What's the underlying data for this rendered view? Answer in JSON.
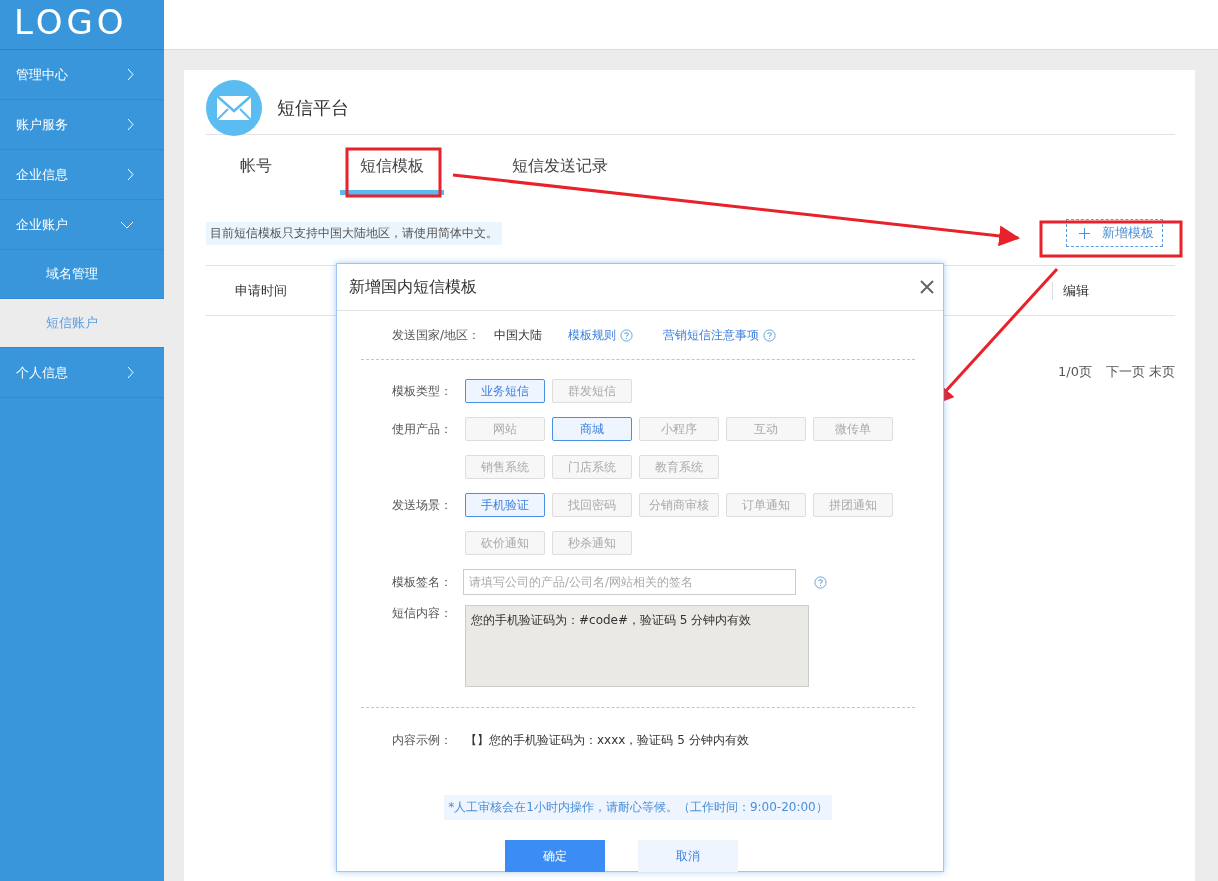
{
  "logo": "LOGO",
  "sidebar": {
    "items": [
      {
        "label": "管理中心",
        "expanded": false
      },
      {
        "label": "账户服务",
        "expanded": false
      },
      {
        "label": "企业信息",
        "expanded": false
      },
      {
        "label": "企业账户",
        "expanded": true,
        "children": [
          {
            "label": "域名管理",
            "selected": false
          },
          {
            "label": "短信账户",
            "selected": true
          }
        ]
      },
      {
        "label": "个人信息",
        "expanded": false
      }
    ]
  },
  "page_title": "短信平台",
  "tabs": [
    {
      "label": "帐号",
      "selected": false
    },
    {
      "label": "短信模板",
      "selected": true
    },
    {
      "label": "短信发送记录",
      "selected": false
    }
  ],
  "notice": "目前短信模板只支持中国大陆地区，请使用简体中文。",
  "add_button": "新增模板",
  "table": {
    "columns": [
      "申请时间",
      "编辑"
    ]
  },
  "pagination": [
    "1/0页",
    "下一页",
    "末页"
  ],
  "dialog": {
    "title": "新增国内短信模板",
    "region_label": "发送国家/地区：",
    "region_value": "中国大陆",
    "links": [
      {
        "label": "模板规则"
      },
      {
        "label": "营销短信注意事项"
      }
    ],
    "option_groups": [
      {
        "label": "模板类型：",
        "options": [
          {
            "label": "业务短信",
            "selected": true
          },
          {
            "label": "群发短信",
            "selected": false
          }
        ]
      },
      {
        "label": "使用产品：",
        "options": [
          {
            "label": "网站",
            "selected": false
          },
          {
            "label": "商城",
            "selected": true
          },
          {
            "label": "小程序",
            "selected": false
          },
          {
            "label": "互动",
            "selected": false
          },
          {
            "label": "微传单",
            "selected": false
          },
          {
            "label": "销售系统",
            "selected": false
          },
          {
            "label": "门店系统",
            "selected": false
          },
          {
            "label": "教育系统",
            "selected": false
          }
        ]
      },
      {
        "label": "发送场景：",
        "options": [
          {
            "label": "手机验证",
            "selected": true
          },
          {
            "label": "找回密码",
            "selected": false
          },
          {
            "label": "分销商审核",
            "selected": false
          },
          {
            "label": "订单通知",
            "selected": false
          },
          {
            "label": "拼团通知",
            "selected": false
          },
          {
            "label": "砍价通知",
            "selected": false
          },
          {
            "label": "秒杀通知",
            "selected": false
          }
        ]
      }
    ],
    "signature": {
      "label": "模板签名：",
      "placeholder": "请填写公司的产品/公司名/网站相关的签名"
    },
    "content": {
      "label": "短信内容：",
      "value": "您的手机验证码为：#code#，验证码 5 分钟内有效"
    },
    "example": {
      "label": "内容示例：",
      "value": "【】您的手机验证码为：xxxx，验证码 5 分钟内有效"
    },
    "review_notice": "*人工审核会在1小时内操作，请耐心等候。（工作时间：9:00-20:00）",
    "buttons": [
      {
        "label": "确定",
        "kind": "primary"
      },
      {
        "label": "取消",
        "kind": "secondary"
      }
    ]
  }
}
